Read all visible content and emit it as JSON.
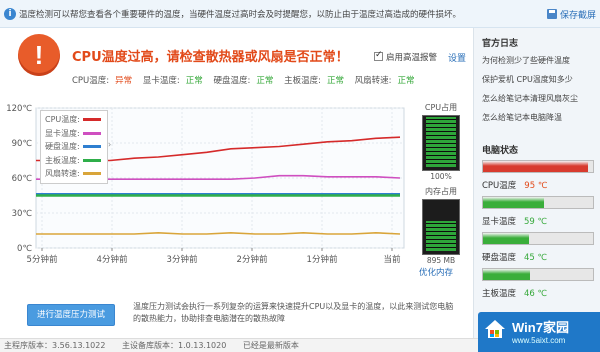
{
  "infobar": {
    "text": "温度检测可以帮您查看各个重要硬件的温度，当硬件温度过高时会及时提醒您，以防止由于温度过高造成的硬件损坏。",
    "save_label": "保存截屏"
  },
  "warning": {
    "title": "CPU温度过高，请检查散热器或风扇是否正常！",
    "alarm_label": "启用高温报警",
    "alarm_checked": true,
    "settings_label": "设置",
    "statuses": [
      {
        "label": "CPU温度:",
        "value": "异常",
        "state": "bad"
      },
      {
        "label": "显卡温度:",
        "value": "正常",
        "state": "ok"
      },
      {
        "label": "硬盘温度:",
        "value": "正常",
        "state": "ok"
      },
      {
        "label": "主板温度:",
        "value": "正常",
        "state": "ok"
      },
      {
        "label": "风扇转速:",
        "value": "正常",
        "state": "ok"
      }
    ]
  },
  "chart_data": {
    "type": "line",
    "x": [
      "5分钟前",
      "4分钟前",
      "3分钟前",
      "2分钟前",
      "1分钟前",
      "当前"
    ],
    "y_ticks": [
      "120℃",
      "90℃",
      "60℃",
      "30℃",
      "0℃"
    ],
    "ylim": [
      0,
      120
    ],
    "series": [
      {
        "name": "CPU温度:",
        "color": "#d52a2a",
        "values": [
          75,
          77,
          78,
          80,
          82,
          85,
          86,
          87,
          89,
          91,
          92,
          94,
          95
        ]
      },
      {
        "name": "显卡温度:",
        "color": "#cf4fc0",
        "values": [
          59,
          59,
          59,
          59,
          59,
          59,
          60,
          62,
          62,
          61,
          61,
          61,
          60
        ]
      },
      {
        "name": "硬盘温度:",
        "color": "#2f7fd0",
        "values": [
          46,
          46,
          46,
          46,
          46,
          46,
          46,
          46,
          46,
          46,
          46,
          46,
          46
        ]
      },
      {
        "name": "主板温度:",
        "color": "#2fae4a",
        "values": [
          45,
          45,
          45,
          45,
          45,
          45,
          45,
          45,
          45,
          45,
          45,
          45,
          45
        ]
      },
      {
        "name": "风扇转速:",
        "color": "#d9a53a",
        "values": [
          12,
          12,
          13,
          12,
          12,
          13,
          12,
          12,
          13,
          12,
          12,
          13,
          12
        ]
      }
    ],
    "grid": true,
    "legend": "top-left"
  },
  "gauges": {
    "cpu": {
      "title": "CPU占用",
      "value": "100%",
      "fraction": 1.0,
      "color": "#2ea63a"
    },
    "memory": {
      "title": "内存占用",
      "value": "895 MB",
      "fraction": 0.55,
      "color": "#2ea63a"
    }
  },
  "optimize_label": "优化内存",
  "stress": {
    "button_label": "进行温度压力测试",
    "description": "温度压力测试会执行一系列复杂的运算来快速提升CPU以及显卡的温度，以此来测试您电脑的散热能力，协助排查电脑潜在的散热故障"
  },
  "footer": {
    "main_version": "主程序版本：3.56.13.1022",
    "db_version": "主设备库版本：1.0.13.1020",
    "status": "已经是最新版本"
  },
  "sidebar": {
    "log_title": "官方日志",
    "logs": [
      "为何检测少了些硬件温度",
      "保护爱机 CPU温度知多少",
      "怎么给笔记本清理风扇灰尘",
      "怎么给笔记本电脑降温"
    ],
    "state_title": "电脑状态",
    "states": [
      {
        "label": "CPU温度",
        "value": "95 ℃",
        "fraction": 0.95,
        "color": "#d83b2e",
        "value_color": "#e24a1a"
      },
      {
        "label": "显卡温度",
        "value": "59 ℃",
        "fraction": 0.55,
        "color": "#3aae3a",
        "value_color": "#36a83a"
      },
      {
        "label": "硬盘温度",
        "value": "45 ℃",
        "fraction": 0.42,
        "color": "#3aae3a",
        "value_color": "#36a83a"
      },
      {
        "label": "主板温度",
        "value": "46 ℃",
        "fraction": 0.43,
        "color": "#3aae3a",
        "value_color": "#36a83a"
      }
    ]
  },
  "watermark": {
    "line1": "Win7家园",
    "line2": "www.5aixt.com"
  }
}
